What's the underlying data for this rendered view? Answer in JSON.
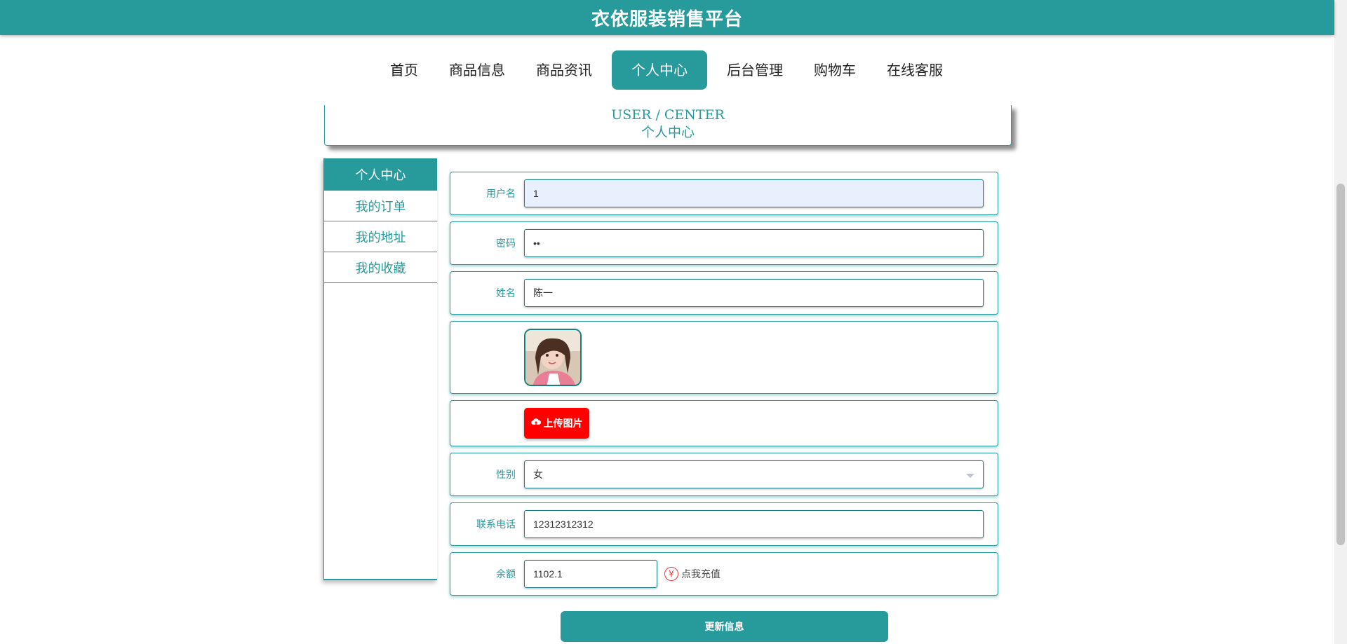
{
  "header": {
    "title": "衣依服装销售平台"
  },
  "nav": {
    "items": [
      {
        "label": "首页"
      },
      {
        "label": "商品信息"
      },
      {
        "label": "商品资讯"
      },
      {
        "label": "个人中心"
      },
      {
        "label": "后台管理"
      },
      {
        "label": "购物车"
      },
      {
        "label": "在线客服"
      }
    ],
    "active": "个人中心"
  },
  "crumb": {
    "en": "USER / CENTER",
    "cn": "个人中心"
  },
  "sidebar": {
    "head": "个人中心",
    "items": [
      {
        "label": "我的订单"
      },
      {
        "label": "我的地址"
      },
      {
        "label": "我的收藏"
      }
    ]
  },
  "form": {
    "username": {
      "label": "用户名",
      "value": "1"
    },
    "password": {
      "label": "密码",
      "value": "••"
    },
    "name": {
      "label": "姓名",
      "value": "陈一"
    },
    "upload": {
      "label": "上传图片",
      "icon": "cloud-upload-icon"
    },
    "gender": {
      "label": "性别",
      "value": "女"
    },
    "phone": {
      "label": "联系电话",
      "value": "12312312312"
    },
    "balance": {
      "label": "余额",
      "value": "1102.1",
      "recharge": "点我充值",
      "icon": "yen-icon"
    },
    "submit": "更新信息"
  },
  "colors": {
    "primary": "#279a9c",
    "upload": "#ff0000",
    "autofill": "#e8f0fe"
  }
}
